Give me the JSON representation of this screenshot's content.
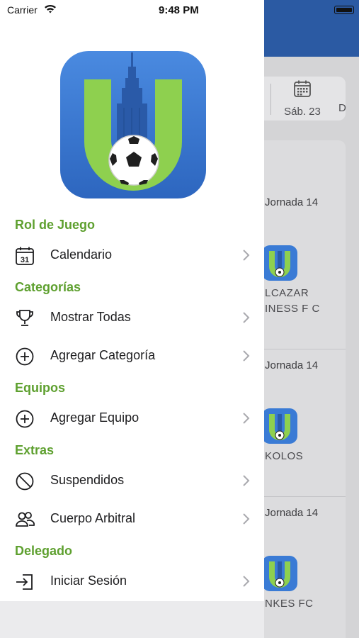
{
  "status_bar": {
    "carrier": "Carrier",
    "time": "9:48 PM"
  },
  "background": {
    "date_label": "Sáb. 23",
    "date_next_partial": "D",
    "matches": [
      {
        "round": "Jornada 14",
        "team_lines": [
          "LCAZAR",
          "INESS F C"
        ]
      },
      {
        "round": "Jornada 14",
        "team_lines": [
          "KOLOS"
        ]
      },
      {
        "round": "Jornada 14",
        "team_lines": [
          "NKES FC"
        ]
      }
    ]
  },
  "drawer": {
    "sections": [
      {
        "title": "Rol de Juego",
        "items": [
          {
            "label": "Calendario",
            "icon": "calendar-icon"
          }
        ]
      },
      {
        "title": "Categorías",
        "items": [
          {
            "label": "Mostrar Todas",
            "icon": "trophy-icon"
          },
          {
            "label": "Agregar Categoría",
            "icon": "add-circle-icon"
          }
        ]
      },
      {
        "title": "Equipos",
        "items": [
          {
            "label": "Agregar Equipo",
            "icon": "add-circle-icon"
          }
        ]
      },
      {
        "title": "Extras",
        "items": [
          {
            "label": "Suspendidos",
            "icon": "prohibited-icon"
          },
          {
            "label": "Cuerpo Arbitral",
            "icon": "people-icon"
          }
        ]
      },
      {
        "title": "Delegado",
        "items": [
          {
            "label": "Iniciar Sesión",
            "icon": "login-icon"
          }
        ]
      }
    ]
  },
  "colors": {
    "section_title": "#5ea02f",
    "header_blue": "#2b5aa3",
    "logo_blue": "#3a7bd5",
    "logo_green": "#8ed04f"
  }
}
